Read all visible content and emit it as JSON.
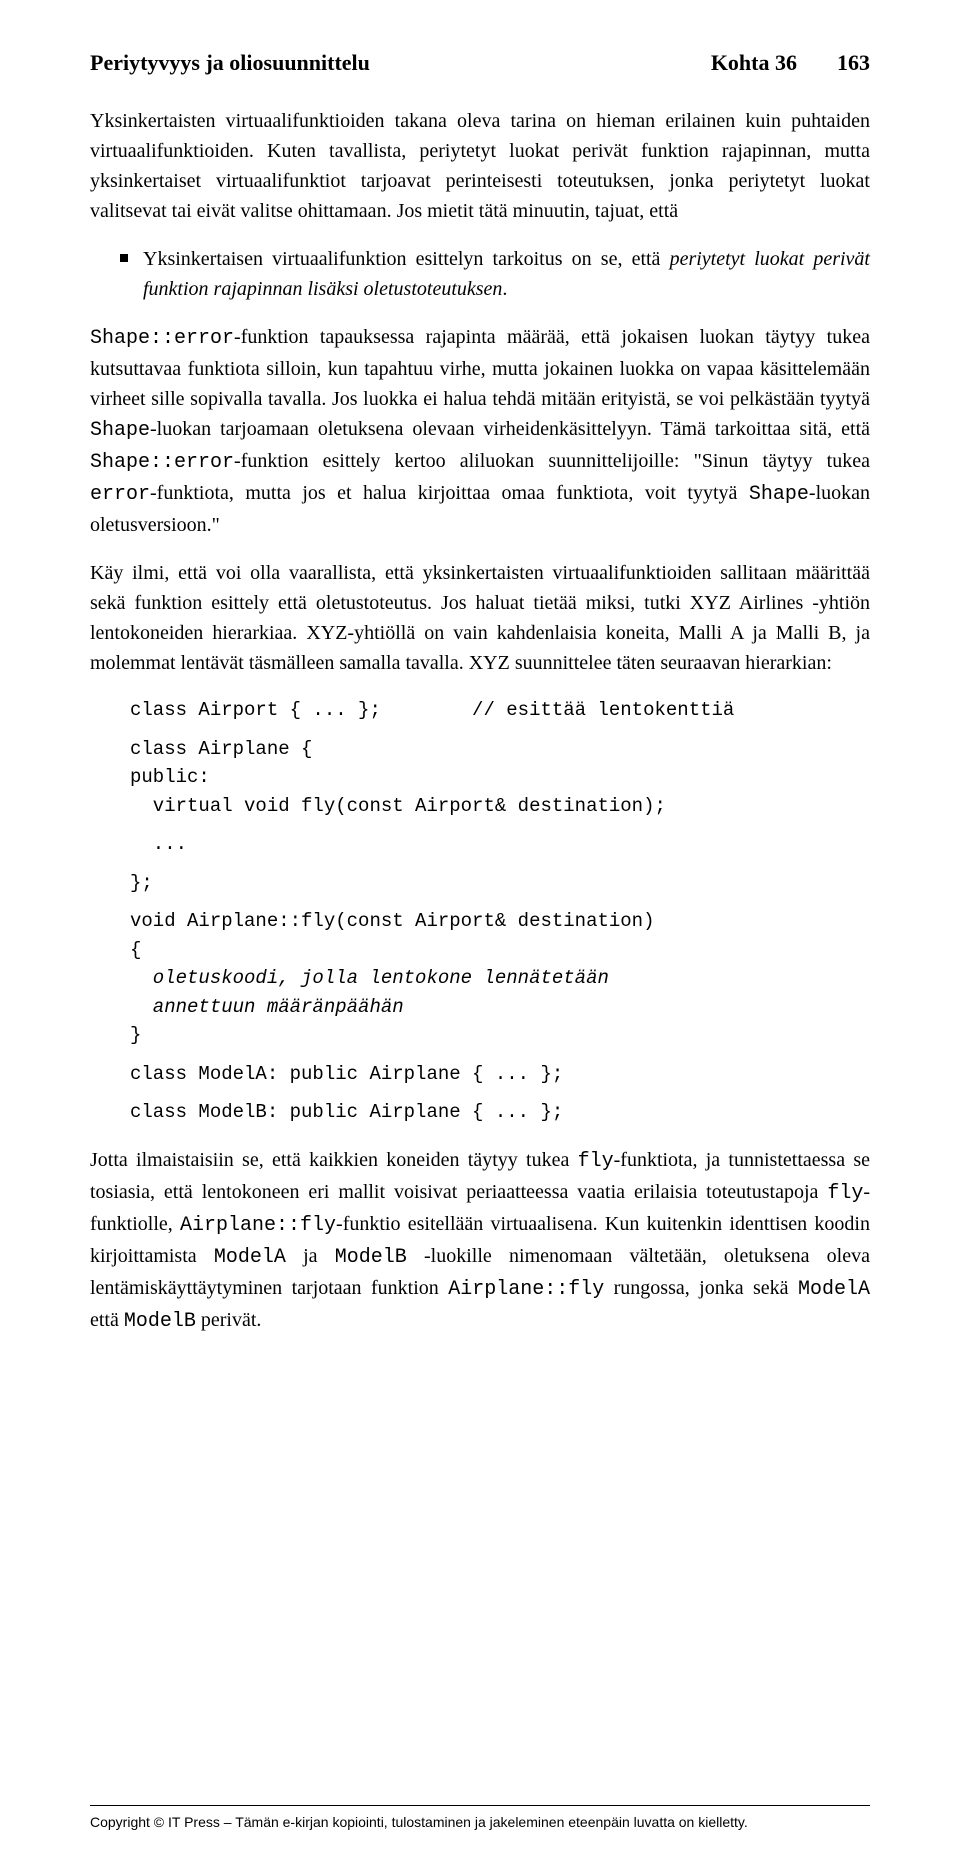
{
  "header": {
    "left": "Periytyvyys ja oliosuunnittelu",
    "section": "Kohta 36",
    "page": "163"
  },
  "para1": "Yksinkertaisten virtuaalifunktioiden takana oleva tarina on hieman erilainen kuin puhtaiden virtuaalifunktioiden. Kuten tavallista, periytetyt luokat perivät funktion rajapinnan, mutta yksinkertaiset virtuaalifunktiot tarjoavat perinteisesti toteutuksen, jonka periytetyt luokat valitsevat tai eivät valitse ohittamaan. Jos mietit tätä minuutin, tajuat, että",
  "bullet1_a": "Yksinkertaisen virtuaalifunktion esittelyn tarkoitus on se, että ",
  "bullet1_b": "periytetyt luokat perivät funktion rajapinnan lisäksi oletustoteutuksen",
  "bullet1_c": ".",
  "para2_a": "Shape::error",
  "para2_b": "-funktion tapauksessa rajapinta määrää, että jokaisen luokan täytyy tukea kutsuttavaa funktiota silloin, kun tapahtuu virhe, mutta jokainen luokka on vapaa käsittelemään virheet sille sopivalla tavalla. Jos luokka ei halua tehdä mitään erityistä, se voi pelkästään tyytyä ",
  "para2_c": "Shape",
  "para2_d": "-luokan tarjoamaan oletuksena olevaan virheidenkäsittelyyn. Tämä tarkoittaa sitä, että ",
  "para2_e": "Shape::error",
  "para2_f": "-funktion esittely kertoo aliluokan suunnittelijoille: \"Sinun täytyy tukea ",
  "para2_g": "error",
  "para2_h": "-funktiota, mutta jos et halua kirjoittaa omaa funktiota, voit tyytyä ",
  "para2_i": "Shape",
  "para2_j": "-luokan oletusversioon.\"",
  "para3": "Käy ilmi, että voi olla vaarallista, että yksinkertaisten virtuaalifunktioiden sallitaan määrittää sekä funktion esittely että oletustoteutus. Jos haluat tietää miksi, tutki XYZ Airlines -yhtiön lentokoneiden hierarkiaa. XYZ-yhtiöllä on vain kahdenlaisia koneita, Malli A ja Malli B, ja molemmat lentävät täsmälleen samalla tavalla. XYZ suunnittelee täten seuraavan hierarkian:",
  "code1": "class Airport { ... };        // esittää lentokenttiä",
  "code2": "class Airplane {\npublic:\n  virtual void fly(const Airport& destination);",
  "code3": "  ...",
  "code4": "};",
  "code5": "void Airplane::fly(const Airport& destination)\n{",
  "code5_italic": "  oletuskoodi, jolla lentokone lennätetään\n  annettuun määränpäähän",
  "code5_end": "}",
  "code6": "class ModelA: public Airplane { ... };",
  "code7": "class ModelB: public Airplane { ... };",
  "para4_a": "Jotta ilmaistaisiin se, että kaikkien koneiden täytyy tukea ",
  "para4_b": "fly",
  "para4_c": "-funktiota, ja tunnistettaessa se tosiasia, että lentokoneen eri mallit voisivat periaatteessa vaatia erilaisia toteutustapoja ",
  "para4_d": "fly",
  "para4_e": "-funktiolle, ",
  "para4_f": "Airplane::fly",
  "para4_g": "-funktio esitellään virtuaalisena. Kun kuitenkin identtisen koodin kirjoittamista ",
  "para4_h": "ModelA",
  "para4_i": " ja ",
  "para4_j": "ModelB",
  "para4_k": " -luokille nimenomaan vältetään, oletuksena oleva lentämiskäyttäytyminen tarjotaan funktion ",
  "para4_l": "Airplane::fly",
  "para4_m": " rungossa, jonka sekä ",
  "para4_n": "ModelA",
  "para4_o": " että ",
  "para4_p": "ModelB",
  "para4_q": " perivät.",
  "footer": "Copyright © IT Press – Tämän e-kirjan kopiointi, tulostaminen ja jakeleminen eteenpäin luvatta on kielletty."
}
